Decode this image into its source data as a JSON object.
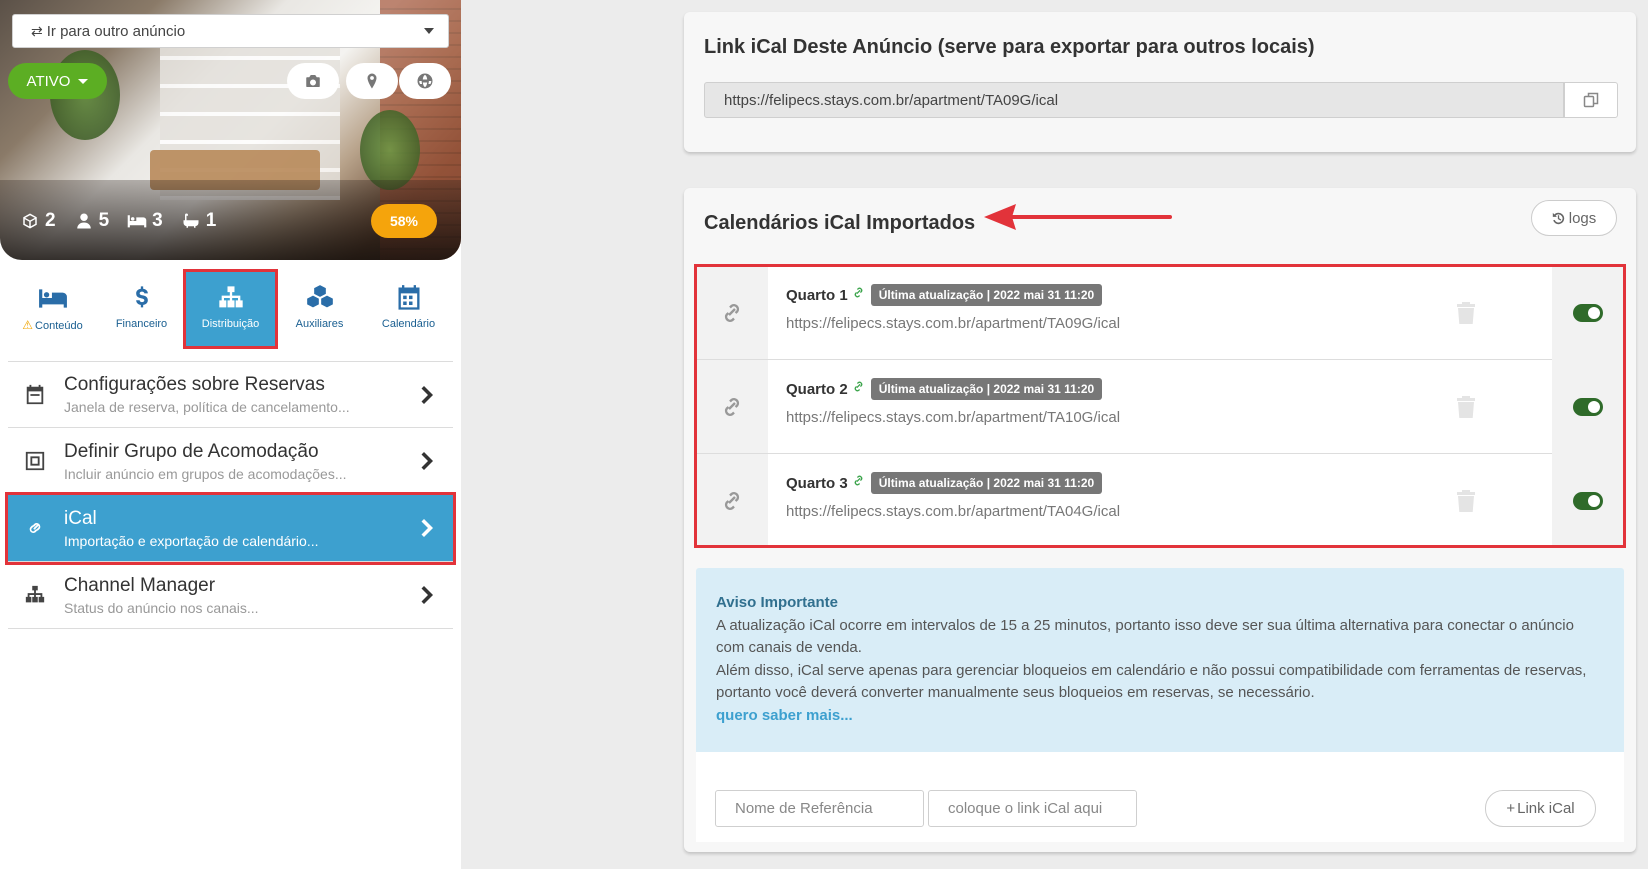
{
  "listing": {
    "goto_label": "Ir para outro anúncio",
    "status_label": "ATIVO",
    "stats": {
      "units": "2",
      "guests": "5",
      "beds": "3",
      "baths": "1"
    },
    "completion": "58%"
  },
  "tabs": [
    {
      "label": "Conteúdo",
      "icon": "bed-icon",
      "warning": true
    },
    {
      "label": "Financeiro",
      "icon": "dollar-icon"
    },
    {
      "label": "Distribuição",
      "icon": "sitemap-icon",
      "active": true
    },
    {
      "label": "Auxiliares",
      "icon": "cubes-icon"
    },
    {
      "label": "Calendário",
      "icon": "calendar-icon"
    }
  ],
  "menu": [
    {
      "title": "Configurações sobre Reservas",
      "subtitle": "Janela de reserva, política de cancelamento...",
      "icon": "calendar-icon"
    },
    {
      "title": "Definir Grupo de Acomodação",
      "subtitle": "Incluir anúncio em grupos de acomodações...",
      "icon": "group-icon"
    },
    {
      "title": "iCal",
      "subtitle": "Importação e exportação de calendário...",
      "icon": "link-icon",
      "active": true
    },
    {
      "title": "Channel Manager",
      "subtitle": "Status do anúncio nos canais...",
      "icon": "sitemap-icon"
    }
  ],
  "export": {
    "title": "Link iCal Deste Anúncio (serve para exportar para outros locais)",
    "url": "https://felipecs.stays.com.br/apartment/TA09G/ical"
  },
  "import": {
    "title": "Calendários iCal Importados",
    "logs_label": "logs",
    "items": [
      {
        "name": "Quarto 1",
        "badge": "Última atualização | 2022 mai 31 11:20",
        "url": "https://felipecs.stays.com.br/apartment/TA09G/ical",
        "enabled": true
      },
      {
        "name": "Quarto 2",
        "badge": "Última atualização | 2022 mai 31 11:20",
        "url": "https://felipecs.stays.com.br/apartment/TA10G/ical",
        "enabled": true
      },
      {
        "name": "Quarto 3",
        "badge": "Última atualização | 2022 mai 31 11:20",
        "url": "https://felipecs.stays.com.br/apartment/TA04G/ical",
        "enabled": true
      }
    ],
    "notice": {
      "title": "Aviso Importante",
      "line1": "A atualização iCal ocorre em intervalos de 15 a 25 minutos, portanto isso deve ser sua última alternativa para conectar o anúncio com canais de venda.",
      "line2": "Além disso, iCal serve apenas para gerenciar bloqueios em calendário e não possui compatibilidade com ferramentas de reservas, portanto você deverá converter manualmente seus bloqueios em reservas, se necessário.",
      "link": "quero saber mais..."
    },
    "add": {
      "name_placeholder": "Nome de Referência",
      "link_placeholder": "coloque o link iCal aqui",
      "button_label": "Link iCal"
    }
  },
  "colors": {
    "accent": "#3da0cf",
    "success": "#5cae23",
    "highlight": "#e2333a",
    "warning": "#f5a40c"
  }
}
